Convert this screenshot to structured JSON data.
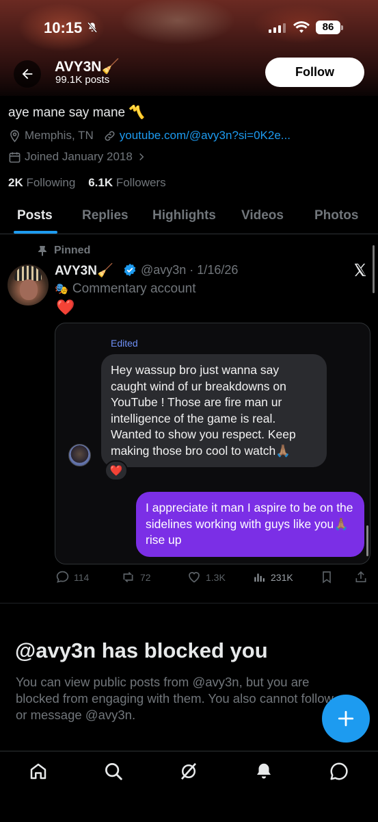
{
  "status_bar": {
    "time": "10:15",
    "battery": "86"
  },
  "header": {
    "name": "AVY3N",
    "name_emoji": "🧹",
    "posts_count": "99.1K posts",
    "follow_label": "Follow"
  },
  "profile": {
    "bio": "aye mane say mane",
    "bio_emoji": "〽️",
    "location": "Memphis, TN",
    "website": "youtube.com/@avy3n?si=0K2e...",
    "joined": "Joined January 2018",
    "following_count": "2K",
    "following_label": "Following",
    "followers_count": "6.1K",
    "followers_label": "Followers"
  },
  "tabs": [
    {
      "label": "Posts",
      "active": true
    },
    {
      "label": "Replies",
      "active": false
    },
    {
      "label": "Highlights",
      "active": false
    },
    {
      "label": "Videos",
      "active": false
    },
    {
      "label": "Photos",
      "active": false
    }
  ],
  "post": {
    "pinned_label": "Pinned",
    "author_name": "AVY3N",
    "author_emoji": "🧹",
    "handle_date": "@avy3n · 1/16/26",
    "account_label": "Commentary account",
    "account_emoji": "🎭",
    "text_emoji": "❤️",
    "dm": {
      "edited_label": "Edited",
      "incoming": "Hey wassup bro just wanna say caught wind of ur breakdowns on YouTube ! Those are fire man ur intelligence of the game is real. Wanted to show you respect. Keep making those bro cool to watch🙏🏽",
      "reaction": "❤️",
      "outgoing": "I appreciate it man I aspire to be on the sidelines working with guys like you🙏🏽rise up"
    },
    "stats": {
      "replies": "114",
      "reposts": "72",
      "likes": "1.3K",
      "views": "231K"
    }
  },
  "blocked": {
    "title": "@avy3n has blocked you",
    "description": "You can view public posts from @avy3n, but you are blocked from engaging with them. You also cannot follow or message @avy3n."
  },
  "colors": {
    "accent": "#1d9bf0",
    "dm_outgoing": "#7b2fe6",
    "muted": "#71767b"
  }
}
